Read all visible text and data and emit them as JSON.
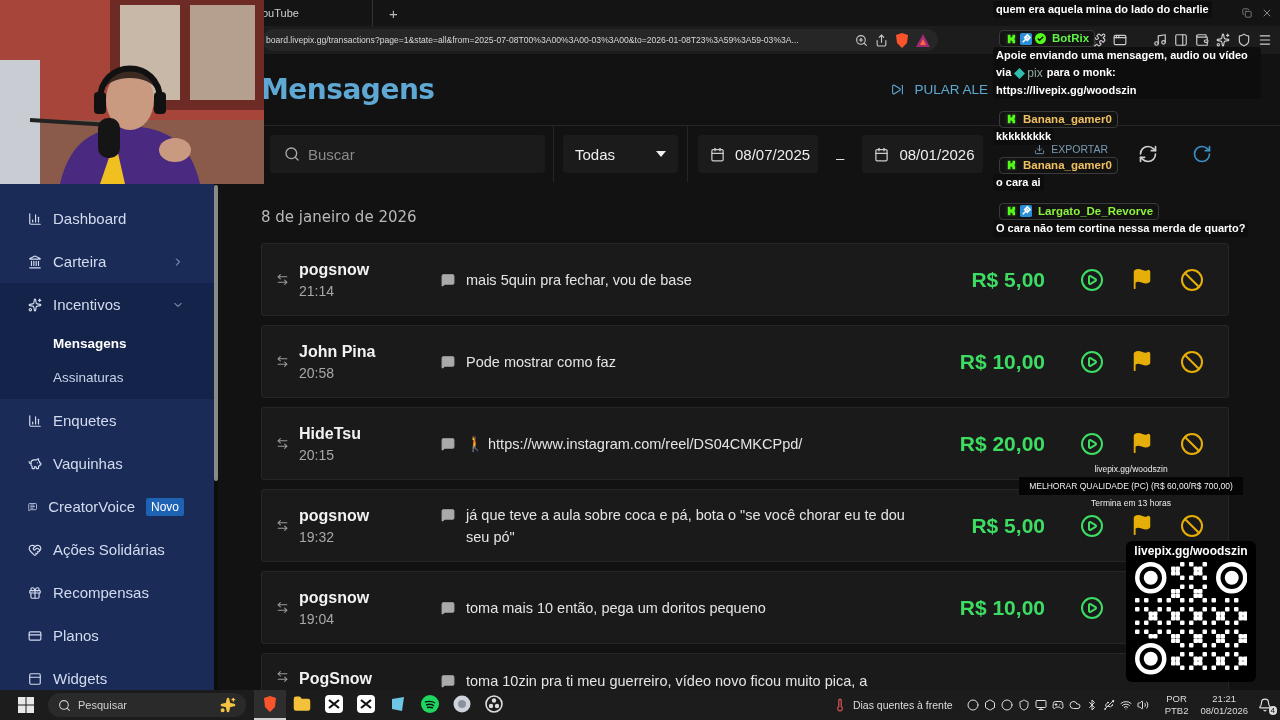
{
  "browser": {
    "tab": {
      "title": "ouTube"
    },
    "new_tab": "+",
    "url": "board.livepix.gg/transactions?page=1&state=all&from=2025-07-08T00%3A00%3A00-03%3A00&to=2026-01-08T23%3A59%3A59-03%3A..."
  },
  "sidebar": {
    "items": [
      {
        "label": "Dashboard",
        "selected": false
      },
      {
        "label": "Carteira",
        "selected": false,
        "expanded": false
      },
      {
        "label": "Incentivos",
        "selected": false,
        "expanded": true,
        "children": [
          {
            "label": "Mensagens",
            "selected": true
          },
          {
            "label": "Assinaturas",
            "selected": false
          }
        ]
      },
      {
        "label": "Enquetes",
        "selected": false
      },
      {
        "label": "Vaquinhas",
        "selected": false
      },
      {
        "label": "CreatorVoice",
        "selected": false,
        "badge": "Novo"
      },
      {
        "label": "Ações Solidárias",
        "selected": false
      },
      {
        "label": "Recompensas",
        "selected": false
      },
      {
        "label": "Planos",
        "selected": false
      },
      {
        "label": "Widgets",
        "selected": false
      }
    ]
  },
  "page": {
    "title": "Mensagens",
    "skip_button": "PULAR ALE"
  },
  "filters": {
    "search": {
      "placeholder": "Buscar"
    },
    "status": "Todas",
    "date_from": "08/07/2025",
    "date_separator": "–",
    "date_to": "08/01/2026",
    "export_button": "EXPORTAR"
  },
  "date_header": "8 de janeiro de 2026",
  "transactions": [
    {
      "name": "pogsnow",
      "time": "21:14",
      "message": "mais 5quin pra fechar, vou de base",
      "amount": "R$ 5,00",
      "actions": [
        {
          "kind": "play"
        },
        {
          "kind": "flag"
        },
        {
          "kind": "block"
        }
      ]
    },
    {
      "name": "John Pina",
      "time": "20:58",
      "message": "Pode mostrar como faz",
      "amount": "R$ 10,00",
      "actions": [
        {
          "kind": "play"
        },
        {
          "kind": "flag"
        },
        {
          "kind": "block"
        }
      ]
    },
    {
      "name": "HideTsu",
      "time": "20:15",
      "message": "🚶 https://www.instagram.com/reel/DS04CMKCPpd/",
      "amount": "R$ 20,00",
      "actions": [
        {
          "kind": "play"
        },
        {
          "kind": "flag"
        },
        {
          "kind": "block"
        }
      ]
    },
    {
      "name": "pogsnow",
      "time": "19:32",
      "message": "já que teve a aula sobre coca e pá, bota o \"se você chorar eu te dou seu pó\"",
      "amount": "R$ 5,00",
      "actions": [
        {
          "kind": "play"
        },
        {
          "kind": "flag"
        },
        {
          "kind": "block"
        }
      ]
    },
    {
      "name": "pogsnow",
      "time": "19:04",
      "message": "toma mais 10 então, pega um doritos pequeno",
      "amount": "R$ 10,00",
      "actions": [
        {
          "kind": "play"
        }
      ]
    },
    {
      "name": "PogSnow",
      "message": "toma 10zin pra ti meu guerreiro, vídeo novo ficou muito pica, a"
    }
  ],
  "goal": {
    "link": "livepix.gg/woodszin",
    "title": "MELHORAR QUALIDADE (PC) (R$ 60,00/R$ 700,00)",
    "ends": "Termina em 13 horas"
  },
  "qr": {
    "link": "livepix.gg/woodszin"
  },
  "chat": {
    "messages": [
      {
        "parts": [
          {
            "kind": "text",
            "text": "quem era aquela mina do lado do charlie"
          }
        ]
      },
      {
        "user": "BotRix",
        "color": "#5cf542",
        "badges": [
          {
            "kind": "kick"
          },
          {
            "kind": "mod"
          },
          {
            "kind": "verified"
          }
        ],
        "parts": [
          {
            "kind": "text",
            "text": "Apoie enviando uma mensagem, audio ou vídeo via"
          },
          {
            "kind": "logo",
            "text": "pix"
          },
          {
            "kind": "text",
            "text": "para o monk: https://livepix.gg/woodszin"
          }
        ]
      },
      {
        "user": "Banana_gamer0",
        "color": "#f0c060",
        "badges": [
          {
            "kind": "kick"
          }
        ],
        "parts": [
          {
            "kind": "text",
            "text": "kkkkkkkkk"
          }
        ]
      },
      {
        "user": "Banana_gamer0",
        "color": "#f0c060",
        "badges": [
          {
            "kind": "kick"
          }
        ],
        "parts": [
          {
            "kind": "text",
            "text": "o cara ai"
          }
        ]
      },
      {
        "user": "Largato_De_Revorve",
        "color": "#8cf23c",
        "badges": [
          {
            "kind": "kick"
          },
          {
            "kind": "mod"
          }
        ],
        "parts": [
          {
            "kind": "text",
            "text": "O cara não tem cortina nessa merda de quarto?"
          }
        ]
      }
    ]
  },
  "taskbar": {
    "search": {
      "placeholder": "Pesquisar"
    },
    "apps": [
      {
        "selected": true
      },
      {
        "selected": false
      },
      {
        "selected": false
      },
      {
        "selected": false
      },
      {
        "selected": false
      },
      {
        "selected": false
      },
      {
        "selected": false
      },
      {
        "selected": false
      }
    ],
    "weather": "Dias quentes à frente",
    "language": "POR",
    "layout": "PTB2",
    "time": "21:21",
    "date": "08/01/2026",
    "notifications": "4"
  }
}
